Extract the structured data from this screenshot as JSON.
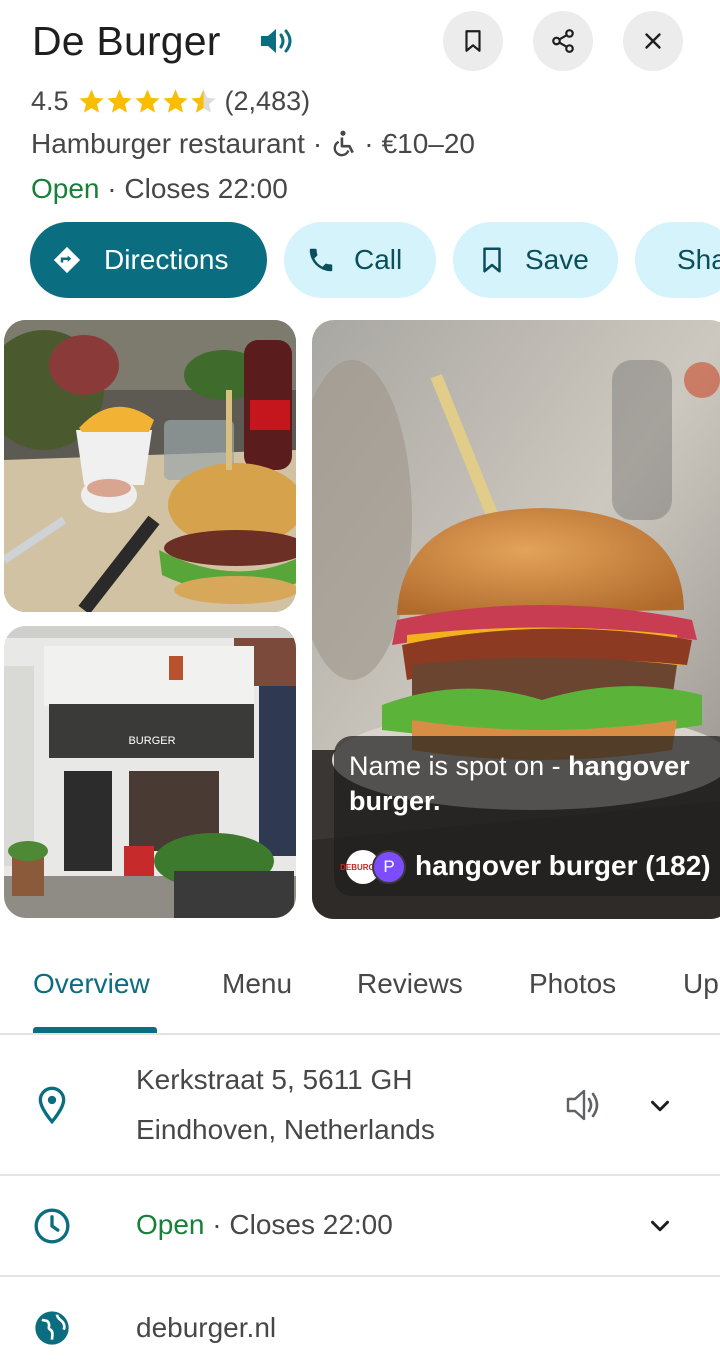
{
  "place": {
    "name": "De Burger",
    "rating": "4.5",
    "stars": 4.5,
    "review_count": "(2,483)",
    "category": "Hamburger restaurant",
    "separator": "·",
    "price_range": "€10–20",
    "status": {
      "open": "Open",
      "separator": "·",
      "closes": "Closes 22:00"
    }
  },
  "top_buttons": {
    "save_icon": "bookmark-icon",
    "share_icon": "share-icon",
    "close_icon": "close-icon"
  },
  "actions": [
    {
      "label": "Directions",
      "icon": "directions-icon"
    },
    {
      "label": "Call",
      "icon": "phone-icon"
    },
    {
      "label": "Save",
      "icon": "bookmark-icon"
    },
    {
      "label": "Share",
      "icon": "share-icon"
    }
  ],
  "review_snippet": {
    "text_plain": "Name is spot on - ",
    "text_bold": "hangover burger.",
    "badge_letter": "P",
    "badge_logo_text": "DEBURGER",
    "dish": "hangover burger (182)"
  },
  "storefront_sign": "BURGER",
  "tabs": [
    "Overview",
    "Menu",
    "Reviews",
    "Photos",
    "Up"
  ],
  "info": {
    "address_line1": "Kerkstraat 5, 5611 GH",
    "address_line2": "Eindhoven, Netherlands",
    "hours_open": "Open",
    "hours_separator": "·",
    "hours_closes": "Closes 22:00",
    "website": "deburger.nl"
  },
  "colors": {
    "accent": "#0b6e80",
    "open_green": "#188038",
    "chip_light": "#d4f3fb",
    "star": "#fbbc04"
  }
}
